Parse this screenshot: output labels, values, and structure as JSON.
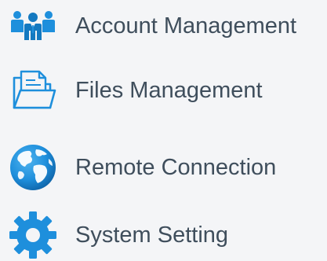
{
  "menu": {
    "items": [
      {
        "label": "Account Management",
        "icon": "users-icon"
      },
      {
        "label": "Files Management",
        "icon": "folder-icon"
      },
      {
        "label": "Remote Connection",
        "icon": "globe-icon"
      },
      {
        "label": "System Setting",
        "icon": "gear-icon"
      }
    ]
  },
  "colors": {
    "icon_blue": "#1e8fdc",
    "icon_blue_dark": "#1479c0",
    "text": "#3f4e5c",
    "background": "#f4f5f7"
  }
}
